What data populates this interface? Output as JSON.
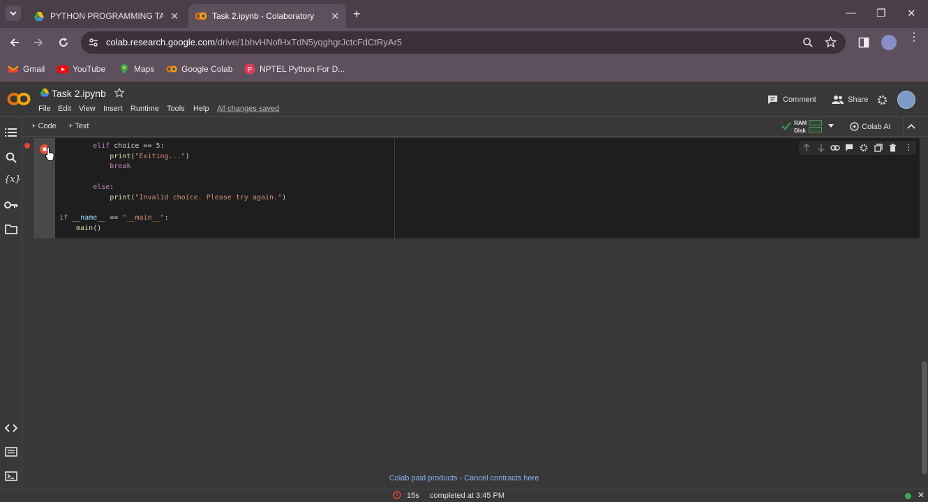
{
  "browser": {
    "tabs": [
      {
        "title": "PYTHON PROGRAMMING TASK",
        "active": false
      },
      {
        "title": "Task 2.ipynb - Colaboratory",
        "active": true
      }
    ],
    "url_host": "colab.research.google.com",
    "url_path": "/drive/1bhvHNofHxTdN5yqghgrJctcFdCtRyAr5",
    "bookmarks": [
      "Gmail",
      "YouTube",
      "Maps",
      "Google Colab",
      "NPTEL Python For D..."
    ]
  },
  "colab": {
    "notebook_title": "Task 2.ipynb",
    "menu": [
      "File",
      "Edit",
      "View",
      "Insert",
      "Runtime",
      "Tools",
      "Help"
    ],
    "saved_status": "All changes saved",
    "comment_label": "Comment",
    "share_label": "Share",
    "add_code_label": "+ Code",
    "add_text_label": "+ Text",
    "ram_label": "RAM",
    "disk_label": "Disk",
    "colab_ai_label": "Colab AI"
  },
  "footer": {
    "paid_products": "Colab paid products",
    "separator": " - ",
    "cancel_contracts": "Cancel contracts here"
  },
  "status": {
    "duration": "15s",
    "completed": "completed at 3:45 PM"
  },
  "colors": {
    "accent_link": "#8ab4f8",
    "tab_strip": "#4a3f48",
    "toolbar": "#5d4f5b",
    "editor_bg": "#1e1e1e"
  }
}
